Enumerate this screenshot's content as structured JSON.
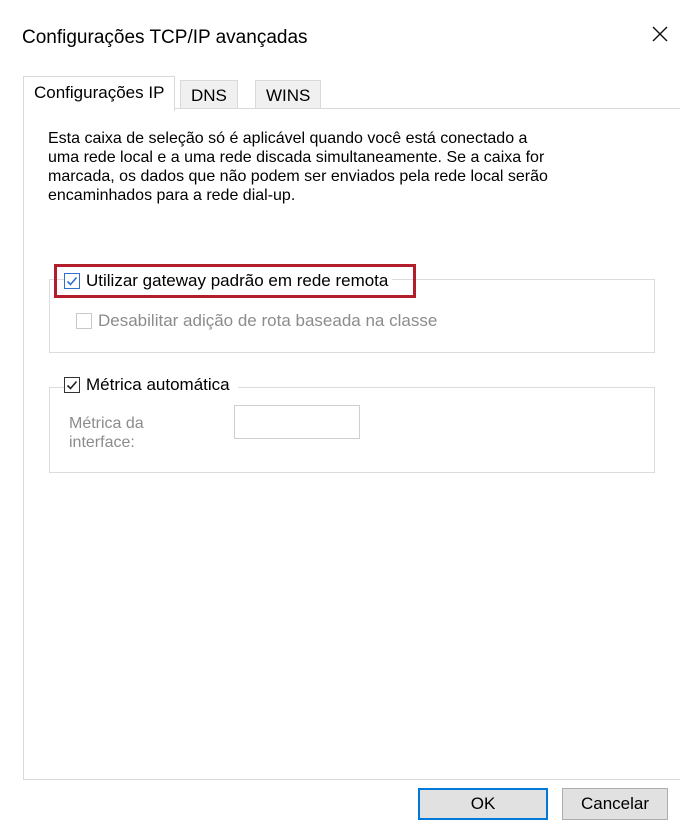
{
  "window": {
    "title": "Configurações TCP/IP avançadas"
  },
  "tabs": [
    {
      "label": "Configurações IP",
      "active": true
    },
    {
      "label": "DNS",
      "active": false
    },
    {
      "label": "WINS",
      "active": false
    }
  ],
  "description": "Esta caixa de seleção só é aplicável quando você está conectado a uma rede local e a uma rede discada simultaneamente. Se a caixa for marcada, os dados que não podem ser enviados pela rede local serão encaminhados para a rede dial-up.",
  "gateway_group": {
    "use_default_gateway": {
      "label": "Utilizar gateway padrão em rede remota",
      "checked": true,
      "highlighted": true
    },
    "disable_class_route": {
      "label": "Desabilitar adição de rota baseada na classe",
      "checked": false,
      "enabled": false
    }
  },
  "metric_group": {
    "automatic_metric": {
      "label": "Métrica automática",
      "checked": true
    },
    "interface_metric": {
      "label": "Métrica da interface:",
      "value": "",
      "enabled": false
    }
  },
  "buttons": {
    "ok": "OK",
    "cancel": "Cancelar"
  },
  "colors": {
    "highlight": "#b31e2d",
    "ok_border": "#0078d7",
    "checkbox_blue": "#2f6fd0"
  },
  "icons": {
    "close": "close-icon",
    "check": "checkmark-icon"
  }
}
